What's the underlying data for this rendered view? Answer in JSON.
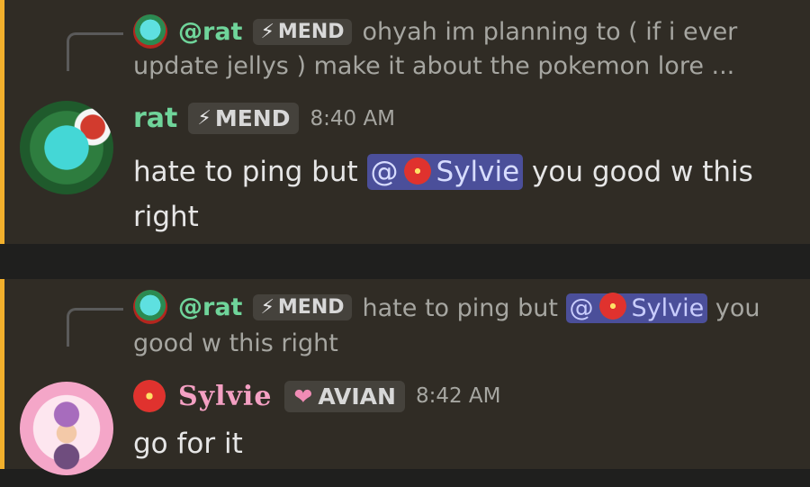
{
  "messages": [
    {
      "reply": {
        "author": "@rat",
        "tag": "MEND",
        "text_line1": "ohyah im planning to ( if i ever",
        "text_line2": "update jellys ) make it about the pokemon lore ..."
      },
      "author": "rat",
      "tag": "MEND",
      "time": "8:40 AM",
      "content_before": "hate to ping but",
      "mention": "@",
      "mention_name": "Sylvie",
      "content_after": "you good w this",
      "content_line2": "right"
    },
    {
      "reply": {
        "author": "@rat",
        "tag": "MEND",
        "text_before": "hate to ping but",
        "mention": "@",
        "mention_name": "Sylvie",
        "text_after": "you",
        "text_line2": "good w this right"
      },
      "author": "Sylvie",
      "tag": "AVIAN",
      "time": "8:42 AM",
      "content": "go for it"
    }
  ],
  "colors": {
    "mention_highlight_bar": "#f2b02c",
    "rat_name": "#6fd49a",
    "sylvie_name": "#f4a0c3",
    "mention_bg": "#4b4f9a"
  },
  "icons": {
    "tag_mend": "lightning-bolt-icon",
    "tag_avian": "pixel-heart-icon",
    "flower": "hibiscus-icon"
  }
}
